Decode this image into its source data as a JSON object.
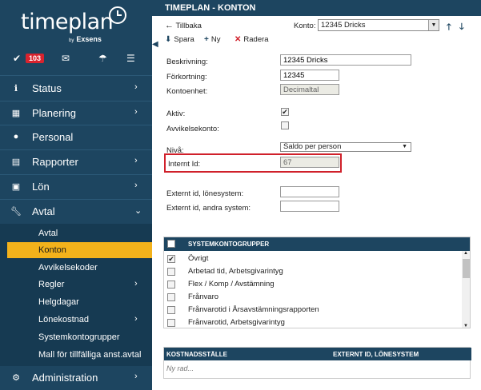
{
  "brand": {
    "name": "timeplan",
    "by": "by",
    "company": "Exsens"
  },
  "toolbar": {
    "notification_count": "103"
  },
  "sidebar": {
    "items": [
      {
        "label": "Status",
        "icon": "info-icon"
      },
      {
        "label": "Planering",
        "icon": "calendar-icon"
      },
      {
        "label": "Personal",
        "icon": "person-icon"
      },
      {
        "label": "Rapporter",
        "icon": "document-icon"
      },
      {
        "label": "Lön",
        "icon": "money-icon"
      },
      {
        "label": "Avtal",
        "icon": "wrench-icon"
      },
      {
        "label": "Administration",
        "icon": "gears-icon"
      }
    ],
    "avtal_sub": [
      {
        "label": "Avtal"
      },
      {
        "label": "Konton"
      },
      {
        "label": "Avvikelsekoder"
      },
      {
        "label": "Regler"
      },
      {
        "label": "Helgdagar"
      },
      {
        "label": "Lönekostnad"
      },
      {
        "label": "Systemkontogrupper"
      },
      {
        "label": "Mall för tillfälliga anst.avtal"
      }
    ]
  },
  "header": {
    "title": "TIMEPLAN - KONTON",
    "back_label": "Tillbaka",
    "konto_label": "Konto:",
    "konto_value": "12345 Dricks"
  },
  "actions": {
    "save": "Spara",
    "new": "Ny",
    "delete": "Radera"
  },
  "form": {
    "beskrivning_label": "Beskrivning:",
    "beskrivning_value": "12345 Dricks",
    "forkortning_label": "Förkortning:",
    "forkortning_value": "12345",
    "kontoenhet_label": "Kontoenhet:",
    "kontoenhet_value": "Decimaltal",
    "aktiv_label": "Aktiv:",
    "aktiv_checked": true,
    "avvikelsekonto_label": "Avvikelsekonto:",
    "avvikelsekonto_checked": false,
    "niva_label": "Nivå:",
    "niva_value": "Saldo per person",
    "internt_id_label": "Internt Id:",
    "internt_id_value": "67",
    "externt_lon_label": "Externt id, lönesystem:",
    "externt_lon_value": "",
    "externt_andra_label": "Externt id, andra system:",
    "externt_andra_value": ""
  },
  "systemkontogrupper": {
    "header": "SYSTEMKONTOGRUPPER",
    "rows": [
      {
        "label": "Övrigt",
        "checked": true
      },
      {
        "label": "Arbetad tid, Arbetsgivarintyg",
        "checked": false
      },
      {
        "label": "Flex / Komp / Avstämning",
        "checked": false
      },
      {
        "label": "Frånvaro",
        "checked": false
      },
      {
        "label": "Frånvarotid i Årsavstämningsrapporten",
        "checked": false
      },
      {
        "label": "Frånvarotid, Arbetsgivarintyg",
        "checked": false
      }
    ]
  },
  "kostnadsstalle": {
    "col1": "KOSTNADSSTÄLLE",
    "col2": "EXTERNT ID, LÖNESYSTEM",
    "new_row": "Ny rad..."
  },
  "colors": {
    "navy": "#1d4560",
    "accent": "#f3b21b",
    "badge": "#d9232e",
    "highlight": "#d0202a"
  }
}
